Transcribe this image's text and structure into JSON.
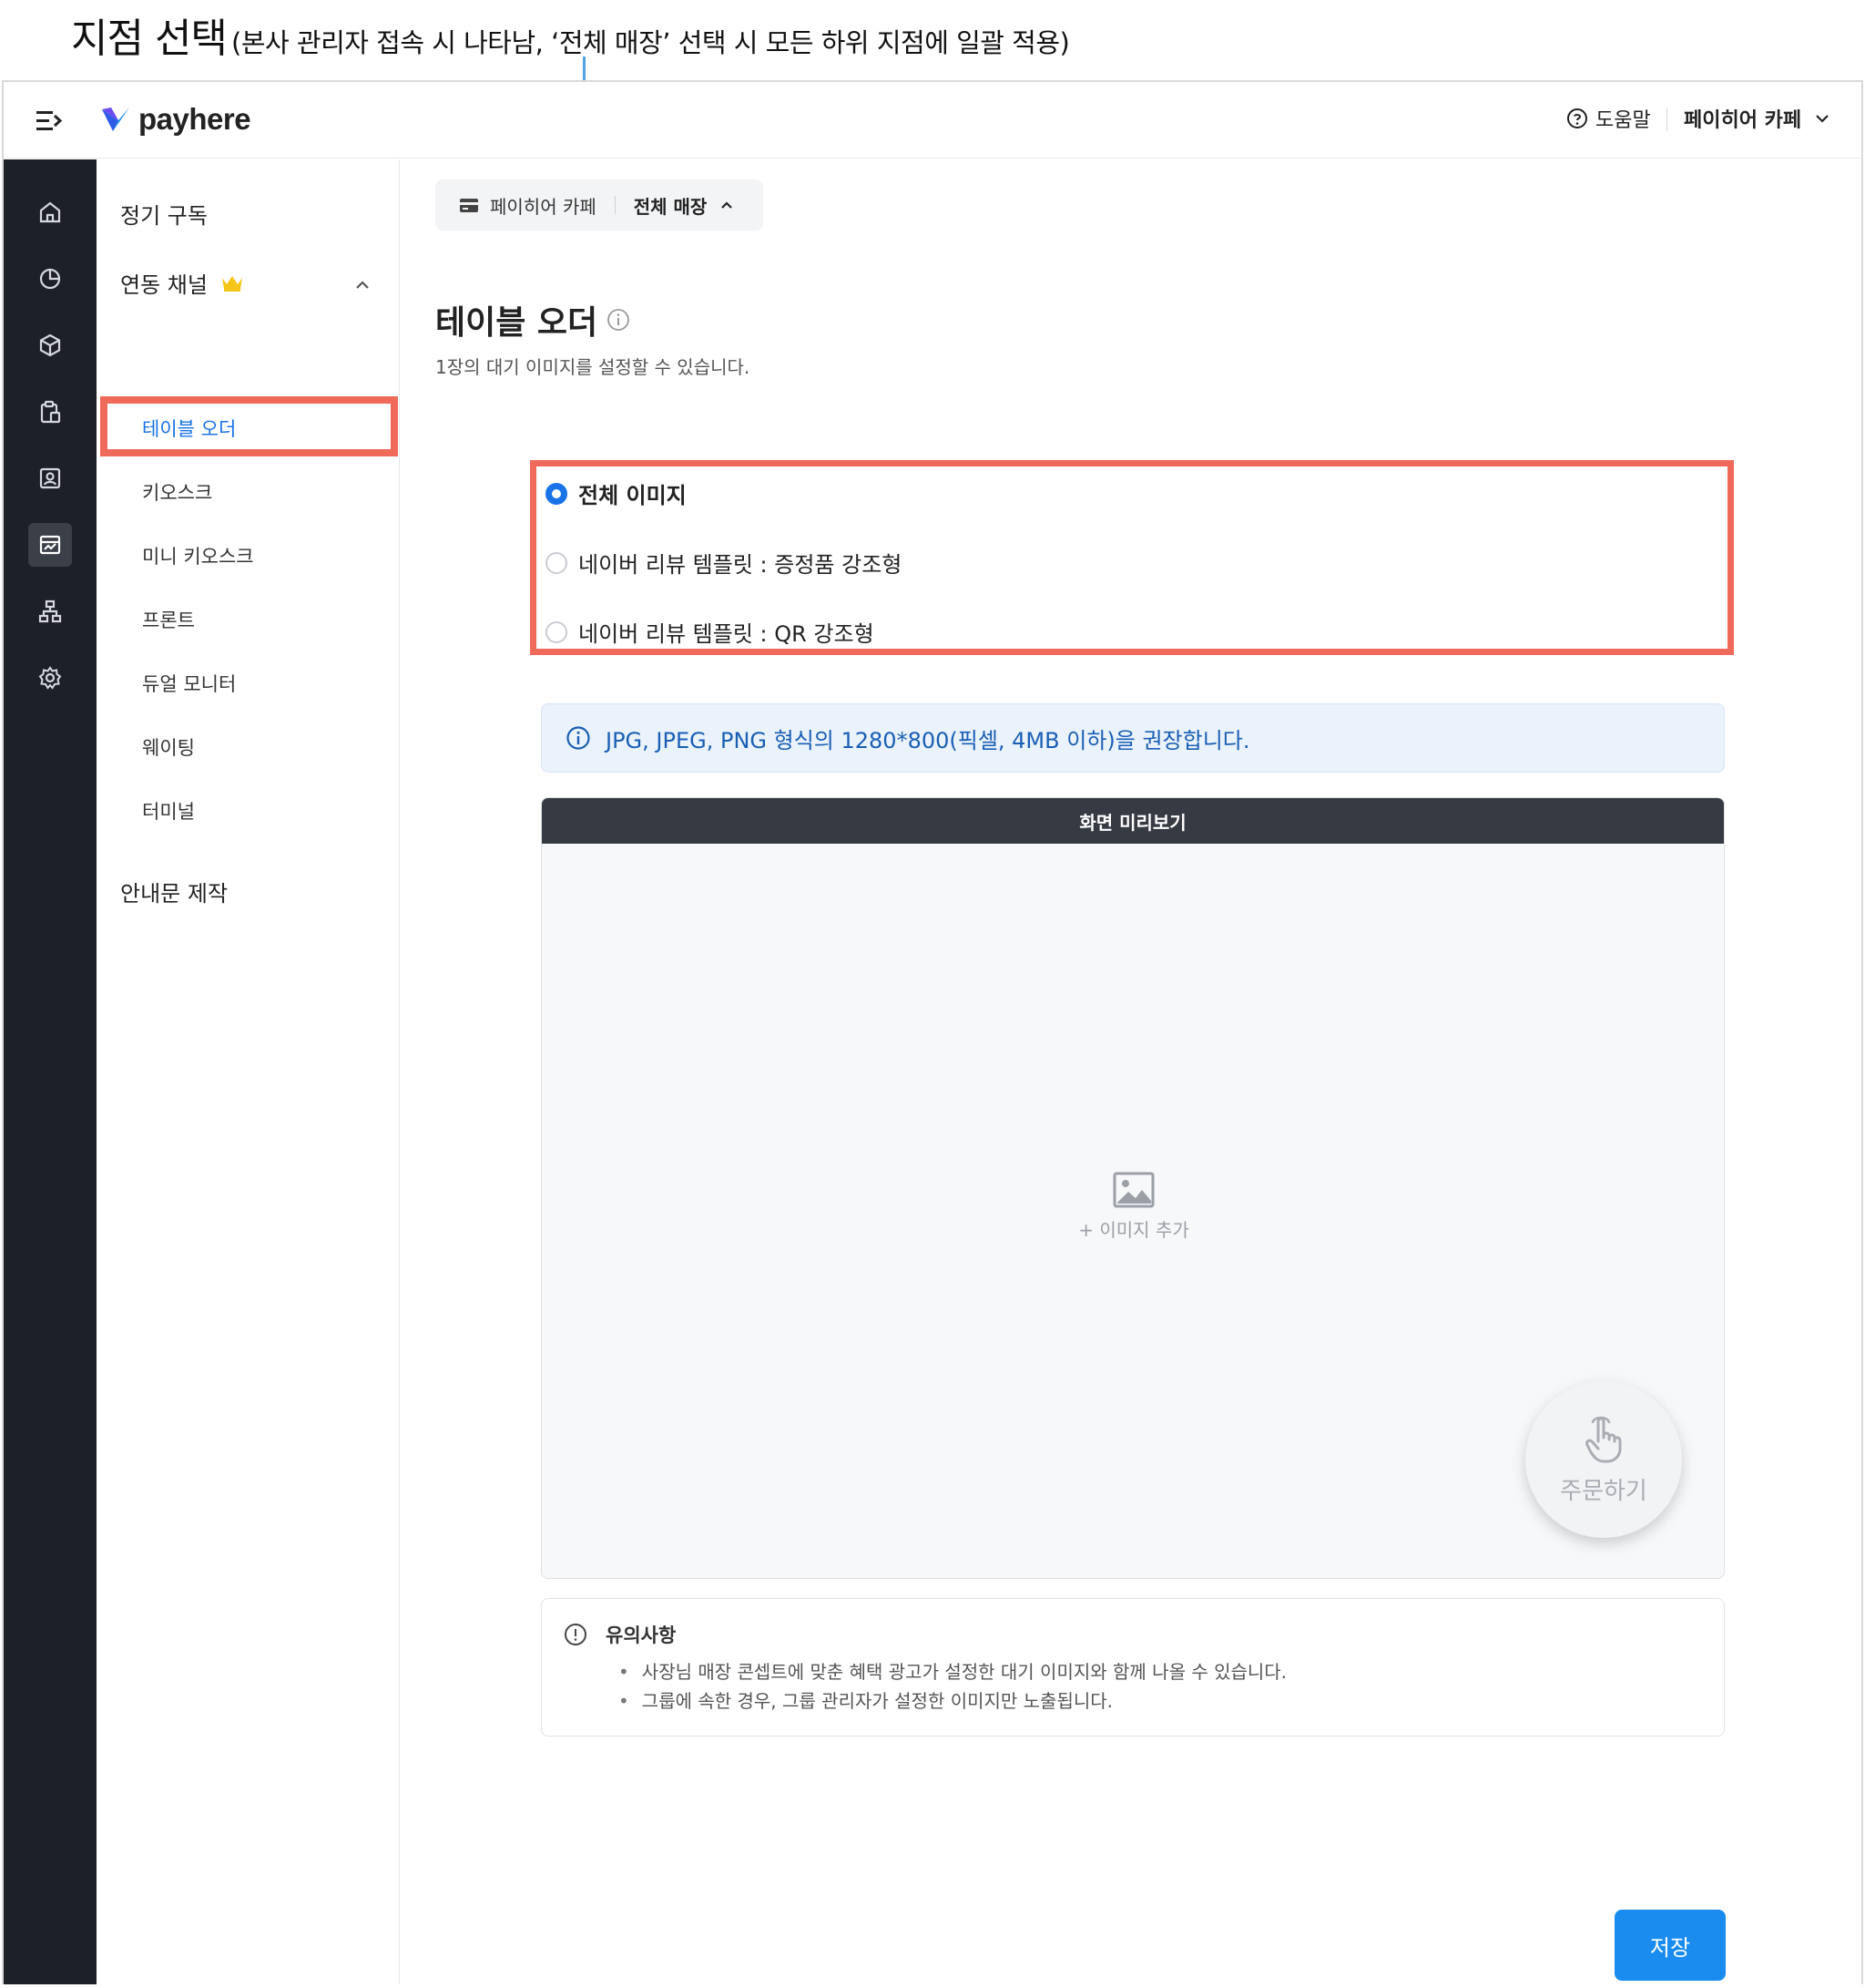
{
  "annotation": {
    "title": "지점 선택",
    "description": "(본사 관리자 접속 시 나타남, ‘전체 매장’ 선택 시 모든 하위 지점에 일괄 적용)"
  },
  "header": {
    "logo_text": "payhere",
    "help_label": "도움말",
    "store_name": "페이히어 카페"
  },
  "rail": {
    "icons": [
      "home-icon",
      "chart-pie-icon",
      "box-icon",
      "clipboard-icon",
      "contact-icon",
      "storefront-icon",
      "org-chart-icon",
      "gear-icon"
    ],
    "active_index": 5
  },
  "submenu": {
    "subscription": "정기 구독",
    "channels": "연동 채널",
    "items": [
      "테이블 오더",
      "키오스크",
      "미니 키오스크",
      "프론트",
      "듀얼 모니터",
      "웨이팅",
      "터미널"
    ],
    "active_item": "테이블 오더",
    "notice_maker": "안내문 제작"
  },
  "store_filter": {
    "store": "페이히어 카페",
    "scope": "전체 매장"
  },
  "page": {
    "title": "테이블 오더",
    "subtitle": "1장의 대기 이미지를 설정할 수 있습니다."
  },
  "radio_options": [
    {
      "label": "전체 이미지",
      "checked": true
    },
    {
      "label": "네이버 리뷰 템플릿 : 증정품 강조형",
      "checked": false
    },
    {
      "label": "네이버 리뷰 템플릿 : QR 강조형",
      "checked": false
    }
  ],
  "info_banner": "JPG, JPEG, PNG 형식의 1280*800(픽셀, 4MB 이하)을 권장합니다.",
  "preview": {
    "header": "화면 미리보기",
    "add_image": "+ 이미지 추가",
    "order_button": "주문하기"
  },
  "notice": {
    "title": "유의사항",
    "items": [
      "사장님 매장 콘셉트에 맞춘 혜택 광고가 설정한 대기 이미지와 함께 나올 수 있습니다.",
      "그룹에 속한 경우, 그룹 관리자가 설정한 이미지만 노출됩니다."
    ]
  },
  "save_label": "저장",
  "colors": {
    "accent": "#1a8cf0",
    "highlight": "#ef6a5a",
    "rail_bg": "#1d2026",
    "annotation_line": "#4fa3e0"
  }
}
